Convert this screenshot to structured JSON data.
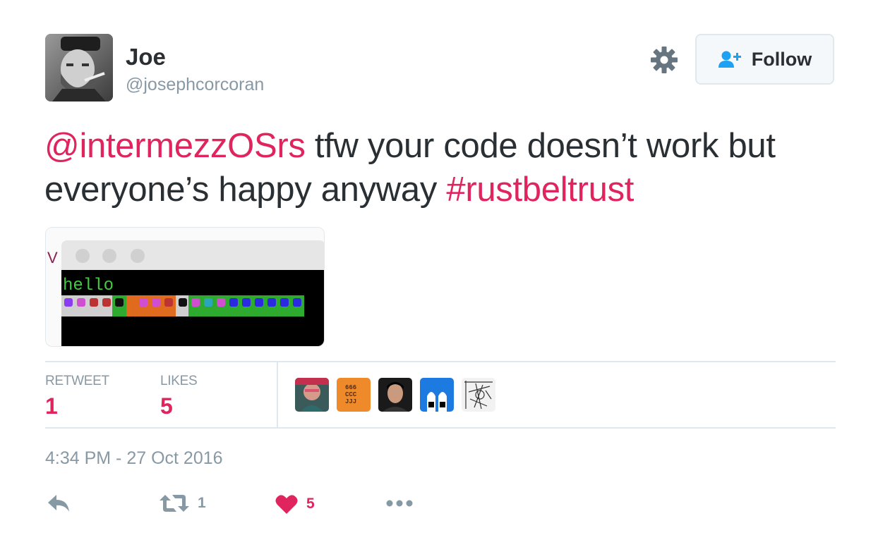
{
  "user": {
    "display_name": "Joe",
    "handle": "@josephcorcoran",
    "avatar_icon": "user-avatar"
  },
  "follow_button": {
    "label": "Follow",
    "icon": "follow-user-icon"
  },
  "settings_icon": "gear-icon",
  "tweet": {
    "mention": "@intermezzOSrs",
    "text": " tfw your code doesn’t work but everyone’s happy anyway ",
    "hashtag": "#rustbeltrust"
  },
  "media": {
    "window_title_fragment": "V",
    "terminal_text": "hello"
  },
  "stats": {
    "retweets_label": "RETWEET",
    "retweets_value": "1",
    "likes_label": "LIKES",
    "likes_value": "5"
  },
  "timestamp": "4:34 PM - 27 Oct 2016",
  "actions": {
    "reply_icon": "reply-icon",
    "retweet_icon": "retweet-icon",
    "retweet_count": "1",
    "like_icon": "heart-icon",
    "like_count": "5",
    "more_icon": "more-icon"
  },
  "colors": {
    "accent": "#e0245e",
    "muted": "#8899a6",
    "text": "#292f33",
    "follow_icon": "#1da1f2",
    "border": "#e1e8ed"
  }
}
